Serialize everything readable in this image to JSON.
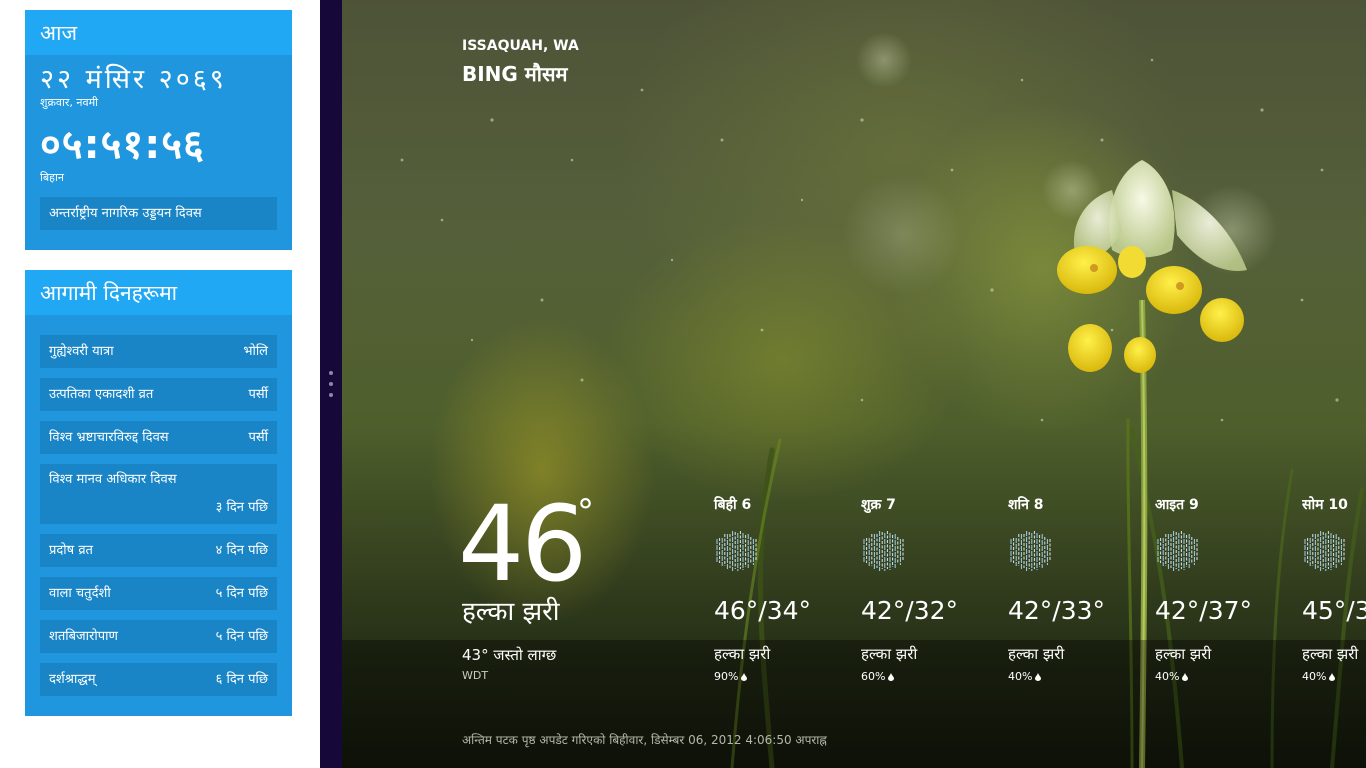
{
  "today": {
    "header": "आज",
    "date": "२२ मंसिर २०६९",
    "weekday": "शुक्रवार, नवमी",
    "time": "०५:५१:५६",
    "period": "बिहान",
    "event": "अन्तर्राष्ट्रीय नागरिक उड्डयन दिवस"
  },
  "upcoming": {
    "header": "आगामी दिनहरूमा",
    "items": [
      {
        "name": "गुह्येश्वरी यात्रा",
        "when": "भोलि"
      },
      {
        "name": "उत्पतिका एकादशी व्रत",
        "when": "पर्सी"
      },
      {
        "name": "विश्व भ्रष्टाचारविरुद्द दिवस",
        "when": "पर्सी"
      },
      {
        "name": "विश्व मानव अधिकार दिवस",
        "when": "३ दिन पछि"
      },
      {
        "name": "प्रदोष व्रत",
        "when": "४ दिन पछि"
      },
      {
        "name": "वाला चतुर्दशी",
        "when": "५ दिन पछि"
      },
      {
        "name": "शतबिजारोपाण",
        "when": "५ दिन पछि"
      },
      {
        "name": "दर्शश्राद्धम्",
        "when": "६ दिन पछि"
      }
    ]
  },
  "weather": {
    "location": "ISSAQUAH, WA",
    "brand": "BING मौसम",
    "current": {
      "temp": "46",
      "degree_symbol": "°",
      "condition": "हल्का झरी",
      "feels_like": "43° जस्तो लाग्छ",
      "station": "WDT"
    },
    "forecast": [
      {
        "day": "बिही 6",
        "range": "46°/34°",
        "condition": "हल्का झरी",
        "precip": "90%",
        "icon": "rain-icon"
      },
      {
        "day": "शुक्र 7",
        "range": "42°/32°",
        "condition": "हल्का झरी",
        "precip": "60%",
        "icon": "rain-icon"
      },
      {
        "day": "शनि 8",
        "range": "42°/33°",
        "condition": "हल्का झरी",
        "precip": "40%",
        "icon": "rain-icon"
      },
      {
        "day": "आइत 9",
        "range": "42°/37°",
        "condition": "हल्का झरी",
        "precip": "40%",
        "icon": "rain-icon"
      },
      {
        "day": "सोम 10",
        "range": "45°/3",
        "condition": "हल्का झरी",
        "precip": "40%",
        "icon": "rain-icon"
      }
    ],
    "last_updated": "अन्तिम पटक पृष्ठ अपडेट गरिएको बिहीवार, डिसेम्बर 06, 2012 4:06:50 अपराह्न"
  },
  "colors": {
    "card_body": "#1f96dd",
    "card_header": "#21a8f5",
    "card_row": "#1985c7",
    "splitter": "#16093a"
  }
}
